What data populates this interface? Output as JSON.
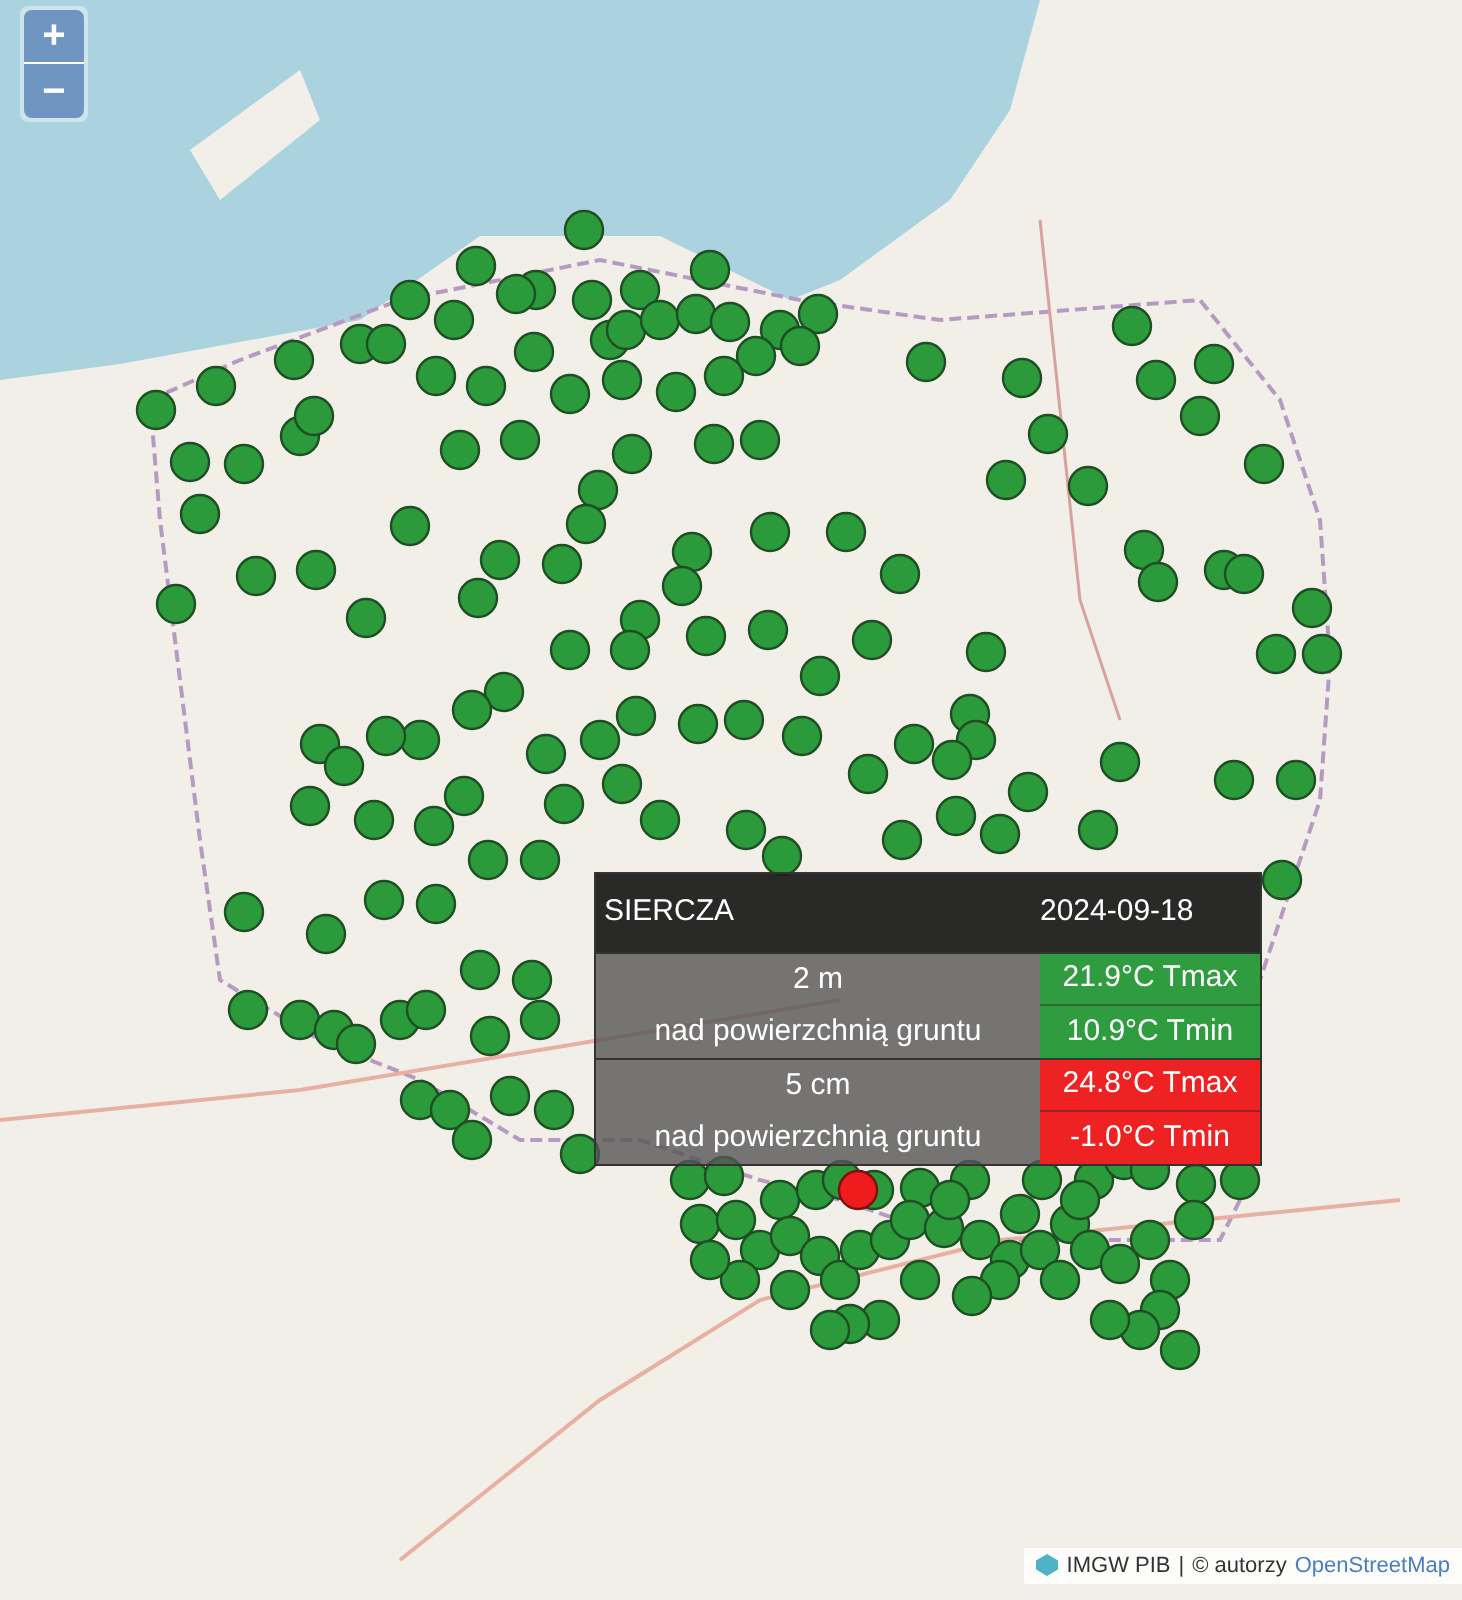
{
  "map": {
    "zoom_controls": [
      {
        "label": "+"
      },
      {
        "label": "−"
      }
    ],
    "station_markers": {
      "color": "#2a9a3a"
    }
  },
  "selected_station": {
    "color": "#ee1c1c"
  },
  "popup": {
    "station": "SIERCZA",
    "date": "2024-09-18",
    "groups": [
      {
        "height": "2 m",
        "label": "nad powierzchnią gruntu",
        "readings": [
          {
            "text": "21.9°C Tmax",
            "color": "#2f9c40"
          },
          {
            "text": "10.9°C Tmin",
            "color": "#2f9c40"
          }
        ]
      },
      {
        "height": "5 cm",
        "label": "nad powierzchnią gruntu",
        "readings": [
          {
            "text": "24.8°C Tmax",
            "color": "#ee2222"
          },
          {
            "text": "-1.0°C Tmin",
            "color": "#ee2222"
          }
        ]
      }
    ]
  },
  "attribution": {
    "source": "IMGW PIB",
    "separator": "|",
    "credit": "© autorzy",
    "link": "OpenStreetMap"
  }
}
